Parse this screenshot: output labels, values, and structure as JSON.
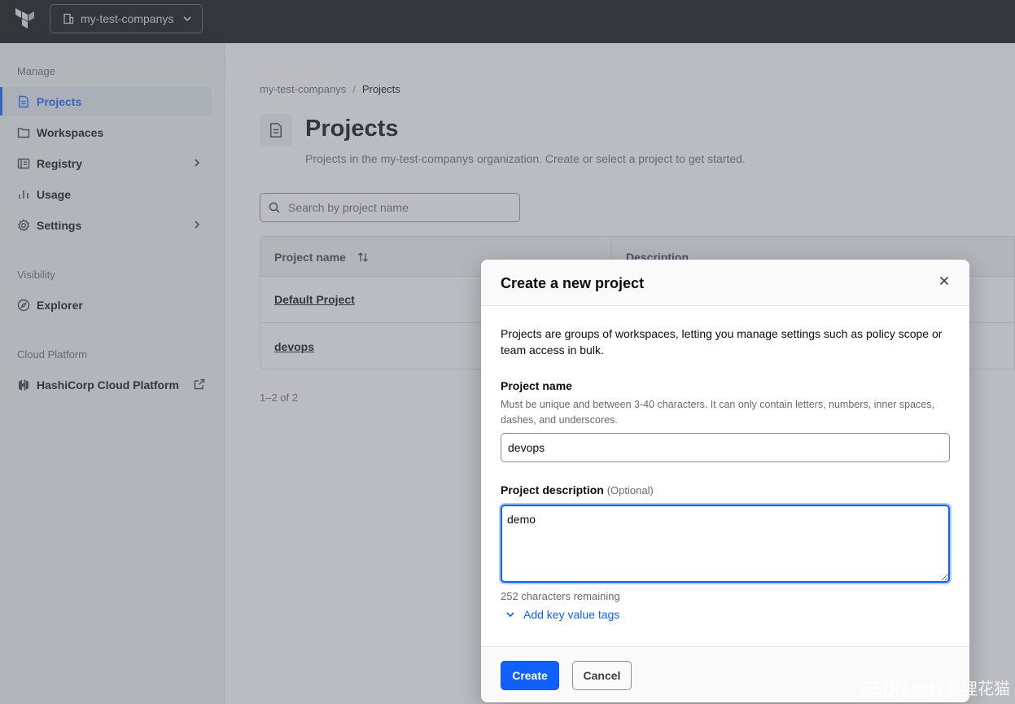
{
  "topbar": {
    "logo_icon": "terraform-logo",
    "org_name": "my-test-companys"
  },
  "sidebar": {
    "sections": [
      {
        "label": "Manage"
      },
      {
        "label": "Visibility"
      },
      {
        "label": "Cloud Platform"
      }
    ],
    "items": [
      {
        "label": "Projects",
        "icon": "file-text-icon",
        "active": true
      },
      {
        "label": "Workspaces",
        "icon": "folder-icon"
      },
      {
        "label": "Registry",
        "icon": "registry-icon",
        "has_submenu": true
      },
      {
        "label": "Usage",
        "icon": "bar-chart-icon"
      },
      {
        "label": "Settings",
        "icon": "gear-icon",
        "has_submenu": true
      },
      {
        "label": "Explorer",
        "icon": "compass-icon"
      },
      {
        "label": "HashiCorp Cloud Platform",
        "icon": "hashicorp-icon",
        "external": true
      }
    ]
  },
  "breadcrumb": {
    "org": "my-test-companys",
    "separator": "/",
    "current": "Projects"
  },
  "page": {
    "title": "Projects",
    "subtitle": "Projects in the my-test-companys organization. Create or select a project to get started."
  },
  "search": {
    "placeholder": "Search by project name"
  },
  "table": {
    "headers": [
      "Project name",
      "Description"
    ],
    "rows": [
      {
        "name": "Default Project"
      },
      {
        "name": "devops"
      }
    ],
    "pagination": "1–2 of 2"
  },
  "modal": {
    "title": "Create a new project",
    "intro": "Projects are groups of workspaces, letting you manage settings such as policy scope or team access in bulk.",
    "name_label": "Project name",
    "name_help": "Must be unique and between 3-40 characters. It can only contain letters, numbers, inner spaces, dashes, and underscores.",
    "name_value": "devops",
    "desc_label": "Project description",
    "desc_optional": "(Optional)",
    "desc_value": "demo",
    "chars_remaining": "252 characters remaining",
    "add_tags": "Add key value tags",
    "create_label": "Create",
    "cancel_label": "Cancel"
  },
  "watermark": "CSDN @炸裂狸花猫",
  "colors": {
    "accent": "#1060ff",
    "topbar": "#0c0c0e",
    "sidebar": "#f1f2f3"
  }
}
